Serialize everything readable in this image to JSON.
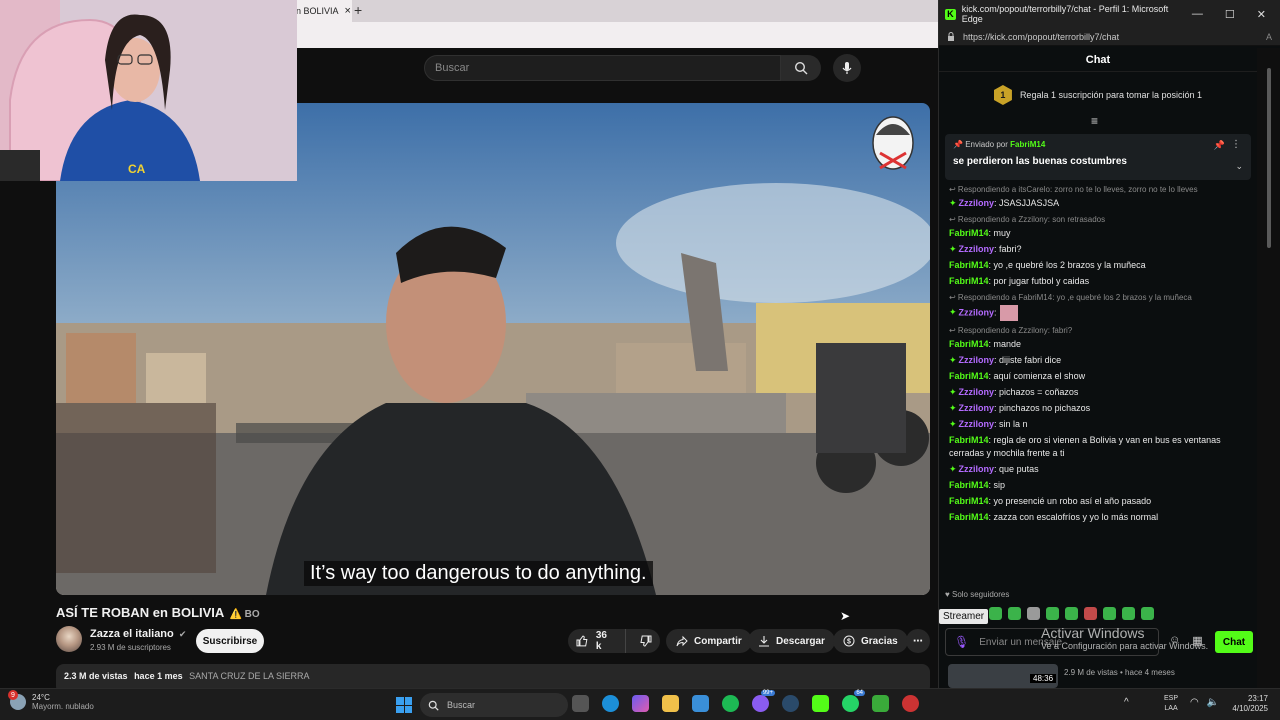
{
  "browser": {
    "tab_title": "n BOLIVIA",
    "tab_close": "×",
    "new_tab": "+"
  },
  "youtube": {
    "search_placeholder": "Buscar",
    "subtitle": "It’s way too dangerous to do anything.",
    "video_title": "ASÍ TE ROBAN en BOLIVIA",
    "title_flag": "⚠️ BO",
    "channel_name": "Zazza el italiano",
    "channel_verified": "✔",
    "subscribers": "2.93 M de suscriptores",
    "subscribe_label": "Suscribirse",
    "like_count": "36 k",
    "share_label": "Compartir",
    "download_label": "Descargar",
    "thanks_label": "Gracias",
    "more_label": "⋯",
    "views": "2.3 M de vistas",
    "posted": "hace 1 mes",
    "location": "SANTA CRUZ DE LA SIERRA"
  },
  "kick": {
    "window_title": "kick.com/popout/terrorbilly7/chat - Perfil 1: Microsoft Edge",
    "url": "https://kick.com/popout/terrorbilly7/chat",
    "url_icon": "A",
    "header": "Chat",
    "gift_rank": "1",
    "gift_text": "Regala 1 suscripción para tomar la posición 1",
    "pinned_by_label": "Enviado por",
    "pinned_by_user": "FabriM14",
    "pinned_message": "se perdieron las buenas costumbres",
    "followers_only": "Solo seguidores",
    "input_placeholder": "Enviar un mensaje",
    "send_label": "Chat",
    "tooltip": "Streamer",
    "messages": [
      {
        "reply": "↩ Respondiendo a itsCarelo: zorro no te lo lleves, zorro no te lo lleves",
        "user": "Zzzilony",
        "badge": "✦",
        "text": ": JSASJJASJSA"
      },
      {
        "reply": "↩ Respondiendo a Zzzilony: son retrasados",
        "user": "FabriM14",
        "text": ": muy"
      },
      {
        "user": "Zzzilony",
        "badge": "✦",
        "text": ": fabri?"
      },
      {
        "user": "FabriM14",
        "text": ": yo ,e quebré los 2 brazos y la muñeca"
      },
      {
        "user": "FabriM14",
        "text": ": por jugar futbol y caidas"
      },
      {
        "reply": "↩ Respondiendo a FabriM14: yo ,e quebré los 2 brazos y la muñeca",
        "user": "Zzzilony",
        "badge": "✦",
        "text": ":",
        "emote": true
      },
      {
        "reply": "↩ Respondiendo a Zzzilony: fabri?",
        "user": "FabriM14",
        "text": ": mande"
      },
      {
        "user": "Zzzilony",
        "badge": "✦",
        "text": ": dijiste fabri dice"
      },
      {
        "user": "FabriM14",
        "text": ": aquí comienza el show"
      },
      {
        "user": "Zzzilony",
        "badge": "✦",
        "text": ": pichazos = coñazos"
      },
      {
        "user": "Zzzilony",
        "badge": "✦",
        "text": ": pinchazos no pichazos"
      },
      {
        "user": "Zzzilony",
        "badge": "✦",
        "text": ": sin la n"
      },
      {
        "user": "FabriM14",
        "text": ": regla de oro si vienen a Bolivia y van en bus es ventanas cerradas y mochila frente a ti"
      },
      {
        "user": "Zzzilony",
        "badge": "✦",
        "text": ": que putas"
      },
      {
        "user": "FabriM14",
        "text": ": sip"
      },
      {
        "user": "FabriM14",
        "text": ": yo presencié un robo así el año pasado"
      },
      {
        "user": "FabriM14",
        "text": ": zazza con escalofríos y yo lo más normal"
      }
    ]
  },
  "overlay": {
    "activate_title": "Activar Windows",
    "activate_sub": "Ve a Configuración para activar Windows.",
    "below_duration": "48:36",
    "below_meta": "2.9 M de vistas  •  hace 4 meses"
  },
  "taskbar": {
    "weather_badge": "9",
    "temperature": "24°C",
    "weather_desc": "Mayorm. nublado",
    "search_placeholder": "Buscar",
    "lang_1": "ESP",
    "lang_2": "LAA",
    "time": "23:17",
    "date": "4/10/2025",
    "badge_messenger": "99+",
    "badge_whatsapp": "64"
  },
  "colors": {
    "kick_green": "#53fc18",
    "zzzilony_purple": "#b46bff",
    "youtube_bg": "#0f0f0f"
  }
}
